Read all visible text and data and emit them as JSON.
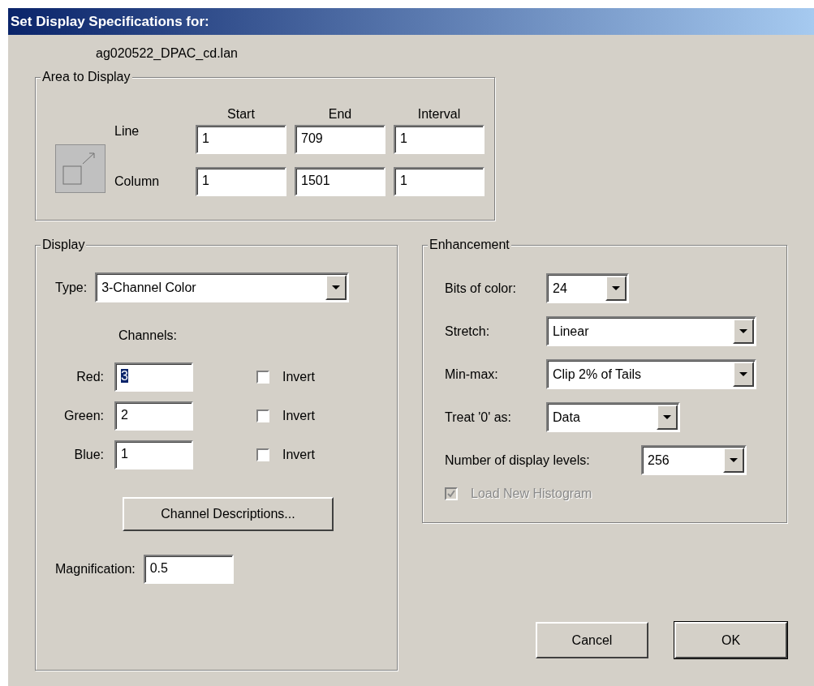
{
  "window": {
    "title": "Set Display Specifications for:"
  },
  "file_name": "ag020522_DPAC_cd.lan",
  "area_to_display": {
    "title": "Area to Display",
    "columns": [
      "Start",
      "End",
      "Interval"
    ],
    "rows": [
      {
        "label": "Line",
        "values": [
          "1",
          "709",
          "1"
        ]
      },
      {
        "label": "Column",
        "values": [
          "1",
          "1501",
          "1"
        ]
      }
    ]
  },
  "display": {
    "title": "Display",
    "type": {
      "label": "Type:",
      "value": "3-Channel Color"
    },
    "channels_label": "Channels:",
    "channels": [
      {
        "label": "Red:",
        "value": "3",
        "highlighted": true,
        "invert": {
          "label": "Invert",
          "checked": false
        }
      },
      {
        "label": "Green:",
        "value": "2",
        "highlighted": false,
        "invert": {
          "label": "Invert",
          "checked": false
        }
      },
      {
        "label": "Blue:",
        "value": "1",
        "highlighted": false,
        "invert": {
          "label": "Invert",
          "checked": false
        }
      }
    ],
    "channel_descriptions_button": "Channel Descriptions...",
    "magnification": {
      "label": "Magnification:",
      "value": "0.5"
    }
  },
  "enhancement": {
    "title": "Enhancement",
    "settings": [
      {
        "label": "Bits of color:",
        "value": "24"
      },
      {
        "label": "Stretch:",
        "value": "Linear"
      },
      {
        "label": "Min-max:",
        "value": "Clip 2% of Tails"
      },
      {
        "label": "Treat '0' as:",
        "value": "Data"
      },
      {
        "label": "Number of display levels:",
        "value": "256"
      }
    ],
    "load_new_histogram": {
      "label": "Load New Histogram",
      "checked": true,
      "disabled": true
    }
  },
  "buttons": [
    {
      "label": "Cancel",
      "default": false
    },
    {
      "label": "OK",
      "default": true
    }
  ]
}
